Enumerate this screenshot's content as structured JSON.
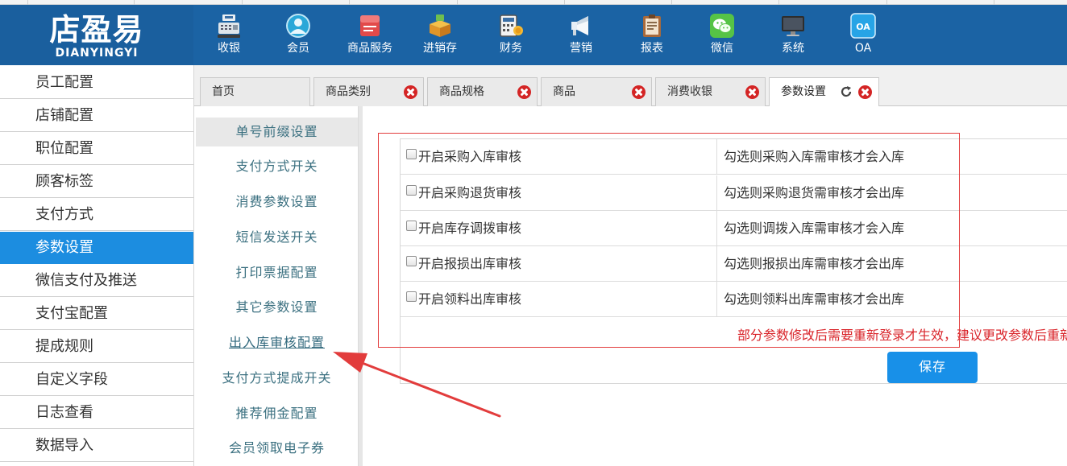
{
  "brand": {
    "name_cn": "店盈易",
    "name_en": "DIANYINGYI"
  },
  "nav": [
    {
      "label": "收银",
      "icon": "cash-register-icon"
    },
    {
      "label": "会员",
      "icon": "member-icon"
    },
    {
      "label": "商品服务",
      "icon": "goods-service-icon"
    },
    {
      "label": "进销存",
      "icon": "inventory-icon"
    },
    {
      "label": "财务",
      "icon": "finance-icon"
    },
    {
      "label": "营销",
      "icon": "megaphone-icon"
    },
    {
      "label": "报表",
      "icon": "report-icon"
    },
    {
      "label": "微信",
      "icon": "wechat-icon"
    },
    {
      "label": "系统",
      "icon": "monitor-icon"
    },
    {
      "label": "OA",
      "icon": "oa-icon",
      "badge": "OA"
    }
  ],
  "sidebar": {
    "items": [
      {
        "label": "员工配置"
      },
      {
        "label": "店铺配置"
      },
      {
        "label": "职位配置"
      },
      {
        "label": "顾客标签"
      },
      {
        "label": "支付方式"
      },
      {
        "label": "参数设置",
        "active": true
      },
      {
        "label": "微信支付及推送"
      },
      {
        "label": "支付宝配置"
      },
      {
        "label": "提成规则"
      },
      {
        "label": "自定义字段"
      },
      {
        "label": "日志查看"
      },
      {
        "label": "数据导入"
      }
    ]
  },
  "tabs": [
    {
      "label": "首页"
    },
    {
      "label": "商品类别"
    },
    {
      "label": "商品规格"
    },
    {
      "label": "商品"
    },
    {
      "label": "消费收银"
    },
    {
      "label": "参数设置",
      "active": true
    }
  ],
  "submenu": {
    "items": [
      {
        "label": "单号前缀设置"
      },
      {
        "label": "支付方式开关"
      },
      {
        "label": "消费参数设置"
      },
      {
        "label": "短信发送开关"
      },
      {
        "label": "打印票据配置"
      },
      {
        "label": "其它参数设置"
      },
      {
        "label": "出入库审核配置"
      },
      {
        "label": "支付方式提成开关"
      },
      {
        "label": "推荐佣金配置"
      },
      {
        "label": "会员领取电子券"
      }
    ]
  },
  "settings": {
    "rows": [
      {
        "label": "开启采购入库审核",
        "description": "勾选则采购入库需审核才会入库",
        "checked": false
      },
      {
        "label": "开启采购退货审核",
        "description": "勾选则采购退货需审核才会出库",
        "checked": false
      },
      {
        "label": "开启库存调拨审核",
        "description": "勾选则调拨入库需审核才会入库",
        "checked": false
      },
      {
        "label": "开启报损出库审核",
        "description": "勾选则报损出库需审核才会出库",
        "checked": false
      },
      {
        "label": "开启领料出库审核",
        "description": "勾选则领料出库需审核才会出库",
        "checked": false
      }
    ],
    "notice": "部分参数修改后需要重新登录才生效，建议更改参数后重新",
    "save_label": "保存"
  },
  "colors": {
    "header": "#1b63a4",
    "sidebar_active": "#1c8de0",
    "save_button": "#1890e8",
    "close_icon": "#d42525",
    "notice": "#d9242a",
    "annotation": "#e23c3c"
  }
}
